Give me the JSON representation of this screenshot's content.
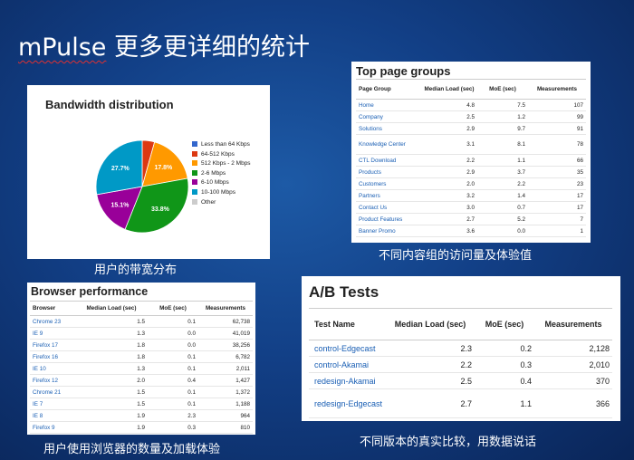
{
  "title": {
    "brand": "mPulse",
    "rest": " 更多更详细的统计"
  },
  "bandwidth": {
    "title": "Bandwidth distribution",
    "caption": "用户的带宽分布",
    "chart_data": {
      "type": "pie",
      "title": "Bandwidth distribution",
      "slices": [
        {
          "label": "Less than 64 Kbps",
          "value": 0.0,
          "color": "#3366cc"
        },
        {
          "label": "64-512 Kbps",
          "value": 4.3,
          "color": "#dc3912"
        },
        {
          "label": "512 Kbps - 2 Mbps",
          "value": 17.8,
          "color": "#ff9900"
        },
        {
          "label": "2-6 Mbps",
          "value": 33.8,
          "color": "#109618"
        },
        {
          "label": "6-10 Mbps",
          "value": 16.1,
          "color": "#990099"
        },
        {
          "label": "10-100 Mbps",
          "value": 27.7,
          "color": "#0099c6"
        },
        {
          "label": "Other",
          "value": 0.0,
          "color": "#cccccc"
        }
      ],
      "data_labels": [
        "17.8%",
        "33.8%",
        "15.1%",
        "27.7%"
      ],
      "legend_position": "right"
    }
  },
  "top_pages": {
    "title": "Top page groups",
    "caption": "不同内容组的访问量及体验值",
    "headers": [
      "Page Group",
      "Median Load (sec)",
      "MoE (sec)",
      "Measurements"
    ],
    "rows": [
      [
        "Home",
        "4.8",
        "7.5",
        "107"
      ],
      [
        "Company",
        "2.5",
        "1.2",
        "99"
      ],
      [
        "Solutions",
        "2.9",
        "9.7",
        "91"
      ],
      [
        "Knowledge Center",
        "3.1",
        "8.1",
        "78"
      ],
      [
        "CTL Download",
        "2.2",
        "1.1",
        "66"
      ],
      [
        "Products",
        "2.9",
        "3.7",
        "35"
      ],
      [
        "Customers",
        "2.0",
        "2.2",
        "23"
      ],
      [
        "Partners",
        "3.2",
        "1.4",
        "17"
      ],
      [
        "Contact Us",
        "3.0",
        "0.7",
        "17"
      ],
      [
        "Product Features",
        "2.7",
        "5.2",
        "7"
      ],
      [
        "Banner Promo",
        "3.6",
        "0.0",
        "1"
      ]
    ]
  },
  "browser": {
    "title": "Browser performance",
    "caption": "用户使用浏览器的数量及加载体验",
    "headers": [
      "Browser",
      "Median Load (sec)",
      "MoE (sec)",
      "Measurements"
    ],
    "rows": [
      [
        "Chrome 23",
        "1.5",
        "0.1",
        "62,738"
      ],
      [
        "IE 9",
        "1.3",
        "0.0",
        "41,019"
      ],
      [
        "Firefox 17",
        "1.8",
        "0.0",
        "38,256"
      ],
      [
        "Firefox 16",
        "1.8",
        "0.1",
        "6,782"
      ],
      [
        "IE 10",
        "1.3",
        "0.1",
        "2,011"
      ],
      [
        "Firefox 12",
        "2.0",
        "0.4",
        "1,427"
      ],
      [
        "Chrome 21",
        "1.5",
        "0.1",
        "1,372"
      ],
      [
        "IE 7",
        "1.5",
        "0.1",
        "1,188"
      ],
      [
        "IE 8",
        "1.9",
        "2.3",
        "964"
      ],
      [
        "Firefox 9",
        "1.9",
        "0.3",
        "810"
      ]
    ]
  },
  "ab": {
    "title": "A/B Tests",
    "caption": "不同版本的真实比较，用数据说话",
    "headers": [
      "Test Name",
      "Median Load (sec)",
      "MoE (sec)",
      "Measurements"
    ],
    "rows": [
      [
        "control-Edgecast",
        "2.3",
        "0.2",
        "2,128"
      ],
      [
        "control-Akamai",
        "2.2",
        "0.3",
        "2,010"
      ],
      [
        "redesign-Akamai",
        "2.5",
        "0.4",
        "370"
      ],
      [
        "redesign-Edgecast",
        "2.7",
        "1.1",
        "366"
      ]
    ]
  }
}
